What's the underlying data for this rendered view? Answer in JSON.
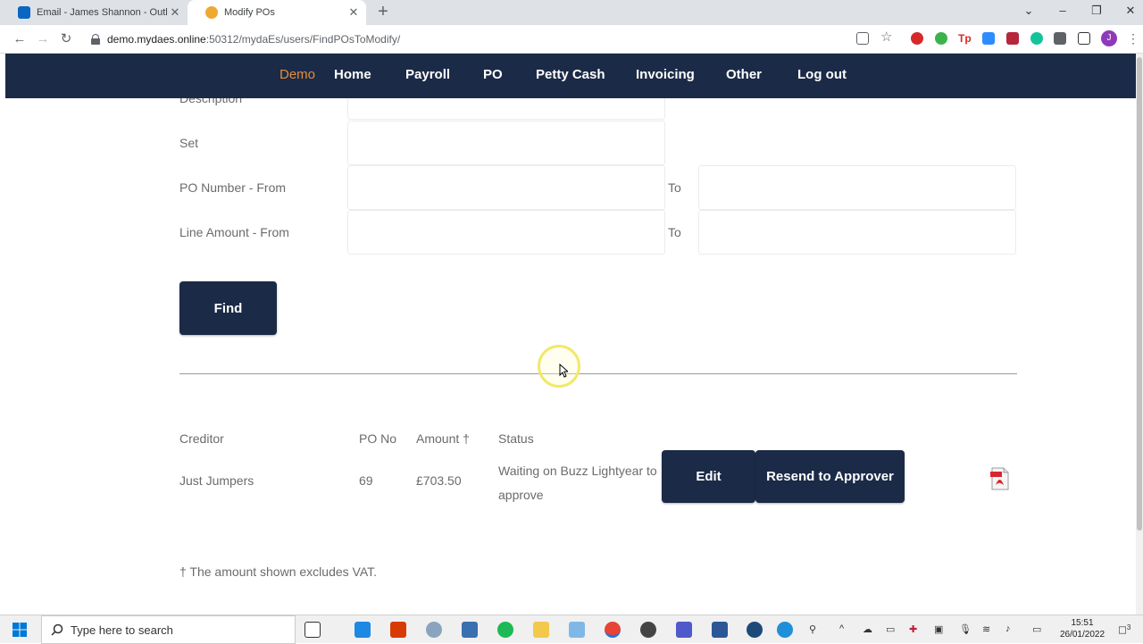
{
  "browser": {
    "tabs": [
      {
        "title": "Email - James Shannon - Outlook",
        "active": false,
        "color": "#0a66c2"
      },
      {
        "title": "Modify POs",
        "active": true,
        "color": "#f0a830"
      }
    ],
    "url_host": "demo.mydaes.online",
    "url_path": ":50312/mydaEs/users/FindPOsToModify/"
  },
  "nav": {
    "brand": "Demo",
    "items": [
      "Home",
      "Payroll",
      "PO",
      "Petty Cash",
      "Invoicing",
      "Other",
      "Log out"
    ]
  },
  "form": {
    "description_label": "Description",
    "set_label": "Set",
    "po_number_label": "PO Number - From",
    "line_amount_label": "Line Amount - From",
    "to_label": "To",
    "find_label": "Find"
  },
  "results": {
    "headers": {
      "creditor": "Creditor",
      "po_no": "PO No",
      "amount": "Amount †",
      "status": "Status"
    },
    "rows": [
      {
        "creditor": "Just Jumpers",
        "po_no": "69",
        "amount": "£703.50",
        "status": "Waiting on Buzz Lightyear to approve"
      }
    ],
    "edit_label": "Edit",
    "resend_label": "Resend to Approver",
    "footnote": "† The amount shown excludes VAT."
  },
  "taskbar": {
    "search_placeholder": "Type here to search",
    "time": "15:51",
    "date": "26/01/2022",
    "notification_count": "3"
  },
  "colors": {
    "navbar": "#1b2a47",
    "brand": "#e88d3a",
    "label": "#6b6b6b"
  }
}
